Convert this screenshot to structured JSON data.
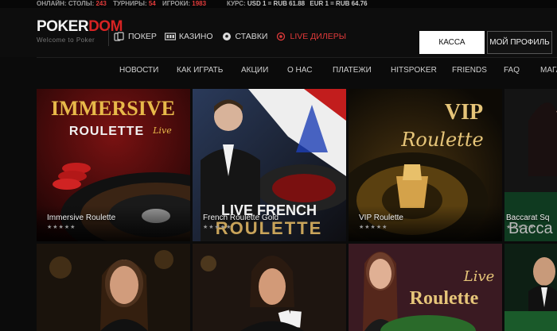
{
  "topbar": {
    "online_label": "ОНЛАЙН:",
    "tables_label": "СТОЛЫ:",
    "tables_value": "243",
    "tournaments_label": "ТУРНИРЫ:",
    "tournaments_value": "54",
    "players_label": "ИГРОКИ:",
    "players_value": "1983",
    "rate_label": "КУРС:",
    "usd_text": "USD 1 = RUB 61.88",
    "eur_text": "EUR 1 = RUB 64.76"
  },
  "logo": {
    "part1": "POKER",
    "part2": "DOM",
    "tagline": "Welcome to Poker"
  },
  "nav": {
    "poker": "ПОКЕР",
    "casino": "КАЗИНО",
    "bets": "СТАВКИ",
    "live": "LIVE ДИЛЕРЫ"
  },
  "buttons": {
    "kassa": "КАССА",
    "profile": "МОЙ ПРОФИЛЬ"
  },
  "subnav": [
    "НОВОСТИ",
    "КАК ИГРАТЬ",
    "АКЦИИ",
    "О НАС",
    "ПЛАТЕЖИ",
    "HITSPOKER",
    "FRIENDS",
    "FAQ",
    "МАГА"
  ],
  "cards": [
    {
      "title": "Immersive Roulette",
      "art_line1": "IMMERSIVE",
      "art_line2": "ROULETTE",
      "art_line3": "Live",
      "stars": "★★★★★"
    },
    {
      "title": "French Roulette Gold",
      "art_line1": "LIVE FRENCH",
      "art_line2": "ROULETTE",
      "stars": "★★★★★"
    },
    {
      "title": "VIP Roulette",
      "art_line1": "VIP",
      "art_line2": "Roulette",
      "stars": "★★★★★"
    },
    {
      "title": "Baccarat Sq",
      "art_line1": "Bacca",
      "stars": "★★★★★"
    },
    {
      "title": ""
    },
    {
      "title": ""
    },
    {
      "title": "",
      "art_line1": "Live",
      "art_line2": "Roulette"
    },
    {
      "title": ""
    }
  ],
  "colors": {
    "accent_red": "#d72323",
    "bg": "#0b0b0b",
    "gold": "#d4a24a"
  }
}
